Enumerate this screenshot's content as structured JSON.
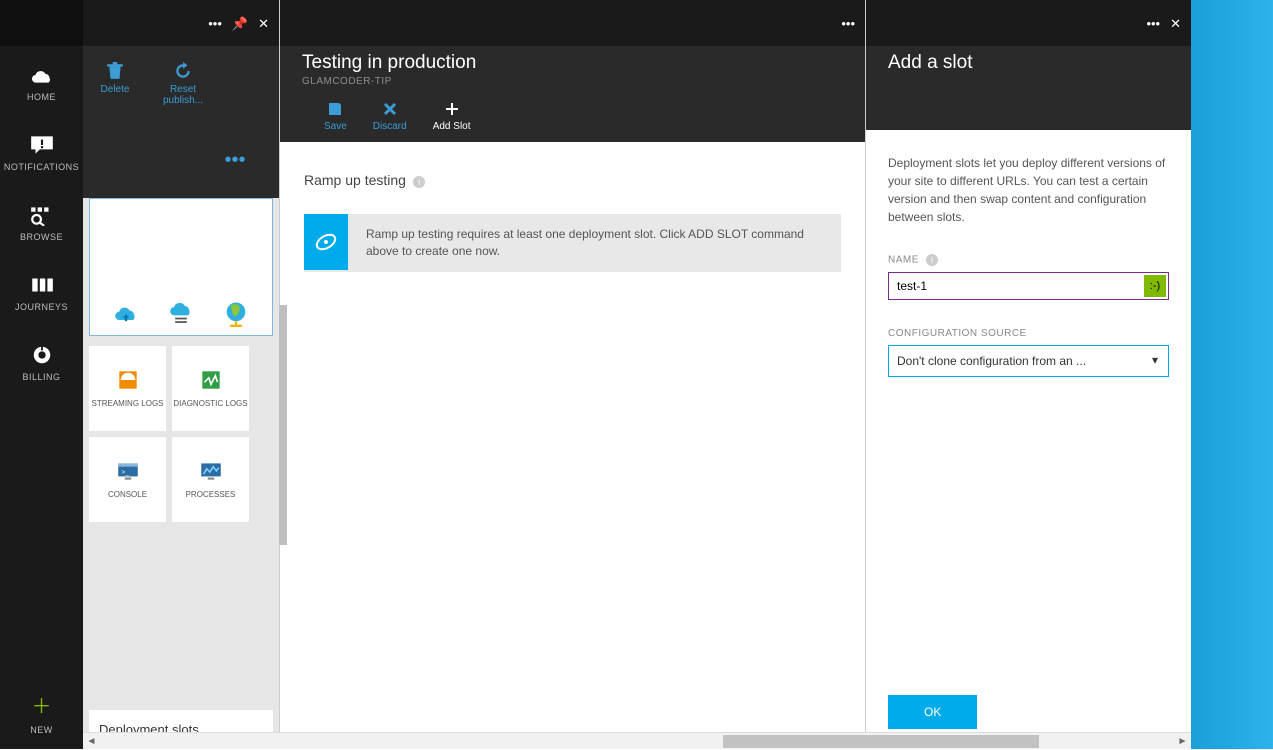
{
  "rail": {
    "home": "HOME",
    "notifications": "NOTIFICATIONS",
    "browse": "BROWSE",
    "journeys": "JOURNEYS",
    "billing": "BILLING",
    "new": "NEW"
  },
  "col1": {
    "toolbar": {
      "delete": "Delete",
      "reset": "Reset publish..."
    },
    "tiles": {
      "streaming_logs": "STREAMING LOGS",
      "diagnostic_logs": "DIAGNOSTIC LOGS",
      "console": "CONSOLE",
      "processes": "PROCESSES"
    },
    "section": "Deployment slots"
  },
  "col2": {
    "title": "Testing in production",
    "subtitle": "GLAMCODER-TIP",
    "toolbar": {
      "save": "Save",
      "discard": "Discard",
      "add_slot": "Add Slot"
    },
    "section_title": "Ramp up testing",
    "banner_text": "Ramp up testing requires at least one deployment slot. Click ADD SLOT command above to create one now."
  },
  "col3": {
    "title": "Add a slot",
    "desc": "Deployment slots let you deploy different versions of your site to different URLs. You can test a certain version and then swap content and configuration between slots.",
    "name_label": "NAME",
    "name_value": "test-1",
    "config_label": "CONFIGURATION SOURCE",
    "config_value": "Don't clone configuration from an ...",
    "ok": "OK"
  }
}
